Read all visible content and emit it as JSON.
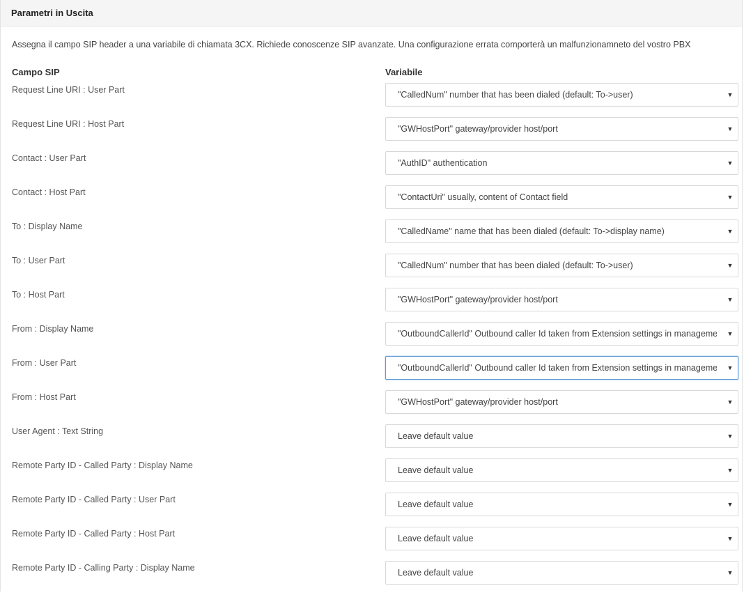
{
  "panel": {
    "title": "Parametri in Uscita",
    "description": "Assegna il campo SIP header a una variabile di chiamata 3CX. Richiede conoscenze SIP avanzate. Una configurazione errata comporterà un malfunzionamneto del vostro PBX",
    "column_sip": "Campo SIP",
    "column_variable": "Variabile"
  },
  "icons": {
    "dropdown": "caret-down-icon",
    "caret_glyph": "▼"
  },
  "rows": [
    {
      "label": "Request Line URI : User Part",
      "value": "\"CalledNum\" number that has been dialed (default: To->user)"
    },
    {
      "label": "Request Line URI : Host Part",
      "value": "\"GWHostPort\" gateway/provider host/port"
    },
    {
      "label": "Contact : User Part",
      "value": "\"AuthID\" authentication"
    },
    {
      "label": "Contact : Host Part",
      "value": "\"ContactUri\" usually, content of Contact field"
    },
    {
      "label": "To : Display Name",
      "value": "\"CalledName\" name that has been dialed (default: To->display name)"
    },
    {
      "label": "To : User Part",
      "value": "\"CalledNum\" number that has been dialed (default: To->user)"
    },
    {
      "label": "To : Host Part",
      "value": "\"GWHostPort\" gateway/provider host/port"
    },
    {
      "label": "From : Display Name",
      "value": "\"OutboundCallerId\" Outbound caller Id taken from Extension settings in management console"
    },
    {
      "label": "From : User Part",
      "value": "\"OutboundCallerId\" Outbound caller Id taken from Extension settings in management console",
      "focused": true
    },
    {
      "label": "From : Host Part",
      "value": "\"GWHostPort\" gateway/provider host/port"
    },
    {
      "label": "User Agent : Text String",
      "value": "Leave default value"
    },
    {
      "label": "Remote Party ID - Called Party : Display Name",
      "value": "Leave default value"
    },
    {
      "label": "Remote Party ID - Called Party : User Part",
      "value": "Leave default value"
    },
    {
      "label": "Remote Party ID - Called Party : Host Part",
      "value": "Leave default value"
    },
    {
      "label": "Remote Party ID - Calling Party : Display Name",
      "value": "Leave default value"
    }
  ]
}
